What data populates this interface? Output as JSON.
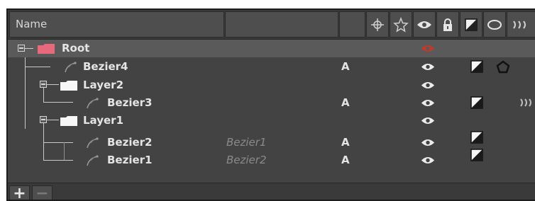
{
  "header": {
    "name_label": "Name",
    "column_icons": [
      "crosshair-icon",
      "star-icon",
      "eye-icon",
      "lock-icon",
      "overlay-icon",
      "ellipse-icon",
      "motion-blur-icon"
    ]
  },
  "rows": [
    {
      "name": "Root",
      "type": "root",
      "mask": "",
      "mode": "",
      "eye": "red"
    },
    {
      "name": "Bezier4",
      "type": "bezier",
      "mask": "",
      "mode": "A",
      "eye": "white"
    },
    {
      "name": "Layer2",
      "type": "layer",
      "mask": "",
      "mode": "",
      "eye": "white"
    },
    {
      "name": "Bezier3",
      "type": "bezier",
      "mask": "",
      "mode": "A",
      "eye": "white"
    },
    {
      "name": "Layer1",
      "type": "layer",
      "mask": "",
      "mode": "",
      "eye": "white"
    },
    {
      "name": "Bezier2",
      "type": "bezier",
      "mask": "Bezier1",
      "mode": "A",
      "eye": "white"
    },
    {
      "name": "Bezier1",
      "type": "bezier",
      "mask": "Bezier2",
      "mode": "A",
      "eye": "white"
    }
  ],
  "footer": {
    "add_label": "+",
    "remove_label": "−"
  },
  "colors": {
    "root_folder": "#e8697b",
    "eye_root": "#c0392b",
    "panel_bg": "#434343"
  }
}
